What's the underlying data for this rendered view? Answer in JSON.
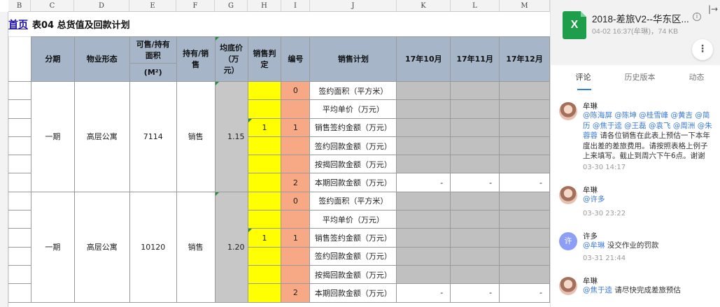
{
  "columns": [
    "B",
    "C",
    "D",
    "E",
    "F",
    "G",
    "H",
    "I",
    "J",
    "K",
    "L",
    "M"
  ],
  "home_link": "首页",
  "sheet_title": "表04 总货值及回款计划",
  "table_header": {
    "phase": "分期",
    "property": "物业形态",
    "area_l1": "可售/持有面积",
    "area_l2": "(M²)",
    "hold": "持有/销售",
    "price": "均底价（万元）",
    "sales_flag": "销售判定",
    "code": "编号",
    "plan": "销售计划",
    "m1": "17年10月",
    "m2": "17年11月",
    "m3": "17年12月"
  },
  "groups": [
    {
      "phase": "一期",
      "property": "高层公寓",
      "area": "7114",
      "hold": "销售",
      "price": "1.15",
      "flag": "1",
      "rows": [
        {
          "code": "0",
          "plan": "签约面积（平方米）",
          "m1": "",
          "m2": "",
          "m3": ""
        },
        {
          "code": "",
          "plan": "平均单价（万元）",
          "m1": "",
          "m2": "",
          "m3": ""
        },
        {
          "code": "1",
          "plan": "销售签约金额（万元）",
          "m1": "",
          "m2": "",
          "m3": ""
        },
        {
          "code": "",
          "plan": "签约回款金额（万元）",
          "m1": "",
          "m2": "",
          "m3": ""
        },
        {
          "code": "",
          "plan": "按揭回款金额（万元）",
          "m1": "",
          "m2": "",
          "m3": ""
        },
        {
          "code": "2",
          "plan": "本期回款金额（万元）",
          "m1": "-",
          "m2": "-",
          "m3": "-"
        }
      ]
    },
    {
      "phase": "一期",
      "property": "高层公寓",
      "area": "10120",
      "hold": "销售",
      "price": "1.20",
      "flag": "1",
      "rows": [
        {
          "code": "0",
          "plan": "签约面积（平方米）",
          "m1": "",
          "m2": "",
          "m3": ""
        },
        {
          "code": "",
          "plan": "平均单价（万元）",
          "m1": "",
          "m2": "",
          "m3": ""
        },
        {
          "code": "1",
          "plan": "销售签约金额（万元）",
          "m1": "",
          "m2": "",
          "m3": ""
        },
        {
          "code": "",
          "plan": "签约回款金额（万元）",
          "m1": "",
          "m2": "",
          "m3": ""
        },
        {
          "code": "",
          "plan": "按揭回款金额（万元）",
          "m1": "",
          "m2": "",
          "m3": ""
        },
        {
          "code": "2",
          "plan": "本期回款金额（万元）",
          "m1": "-",
          "m2": "-",
          "m3": "-"
        }
      ]
    }
  ],
  "panel": {
    "file_icon_letter": "X",
    "file_name": "2018-差旅V2--华东区...",
    "file_meta": "04-02 16:37(牟琳)，74 KB",
    "info_glyph": "i",
    "collapse_glyph": "|→",
    "more_glyph": "⋮",
    "tabs": [
      "评论",
      "历史版本",
      "动态"
    ],
    "comments": [
      {
        "author": "牟琳",
        "mentions": "@陈海屏 @陈坤 @桂雪峰 @黄吉 @简历 @焦于逵 @王磊 @袁飞 @周洲 @朱蓉蓉",
        "text": " 请各位销售在此表上预估一下本年度出差的差旅费用。请按照表格上例子上来填写。截止到周六下午6点。谢谢",
        "time": "03-30 14:17"
      },
      {
        "author": "牟琳",
        "mentions": "@许多",
        "text": "",
        "time": "03-30 23:22"
      },
      {
        "author": "许多",
        "avatar_letter": "许",
        "mentions": "@牟琳",
        "text": " 没交作业的罚款",
        "time": "03-31 21:44"
      },
      {
        "author": "牟琳",
        "mentions": "@焦于逵",
        "text": " 请尽快完成差旅预估",
        "time": ""
      }
    ]
  },
  "colors": {
    "header_bg": "#a6b6c8",
    "yellow": "#ffff00",
    "orange": "#f7a985",
    "grey": "#c0c0c0",
    "excel_green": "#1e9d4b",
    "mention_blue": "#3a7ad8",
    "tab_underline": "#2f7ef0"
  }
}
